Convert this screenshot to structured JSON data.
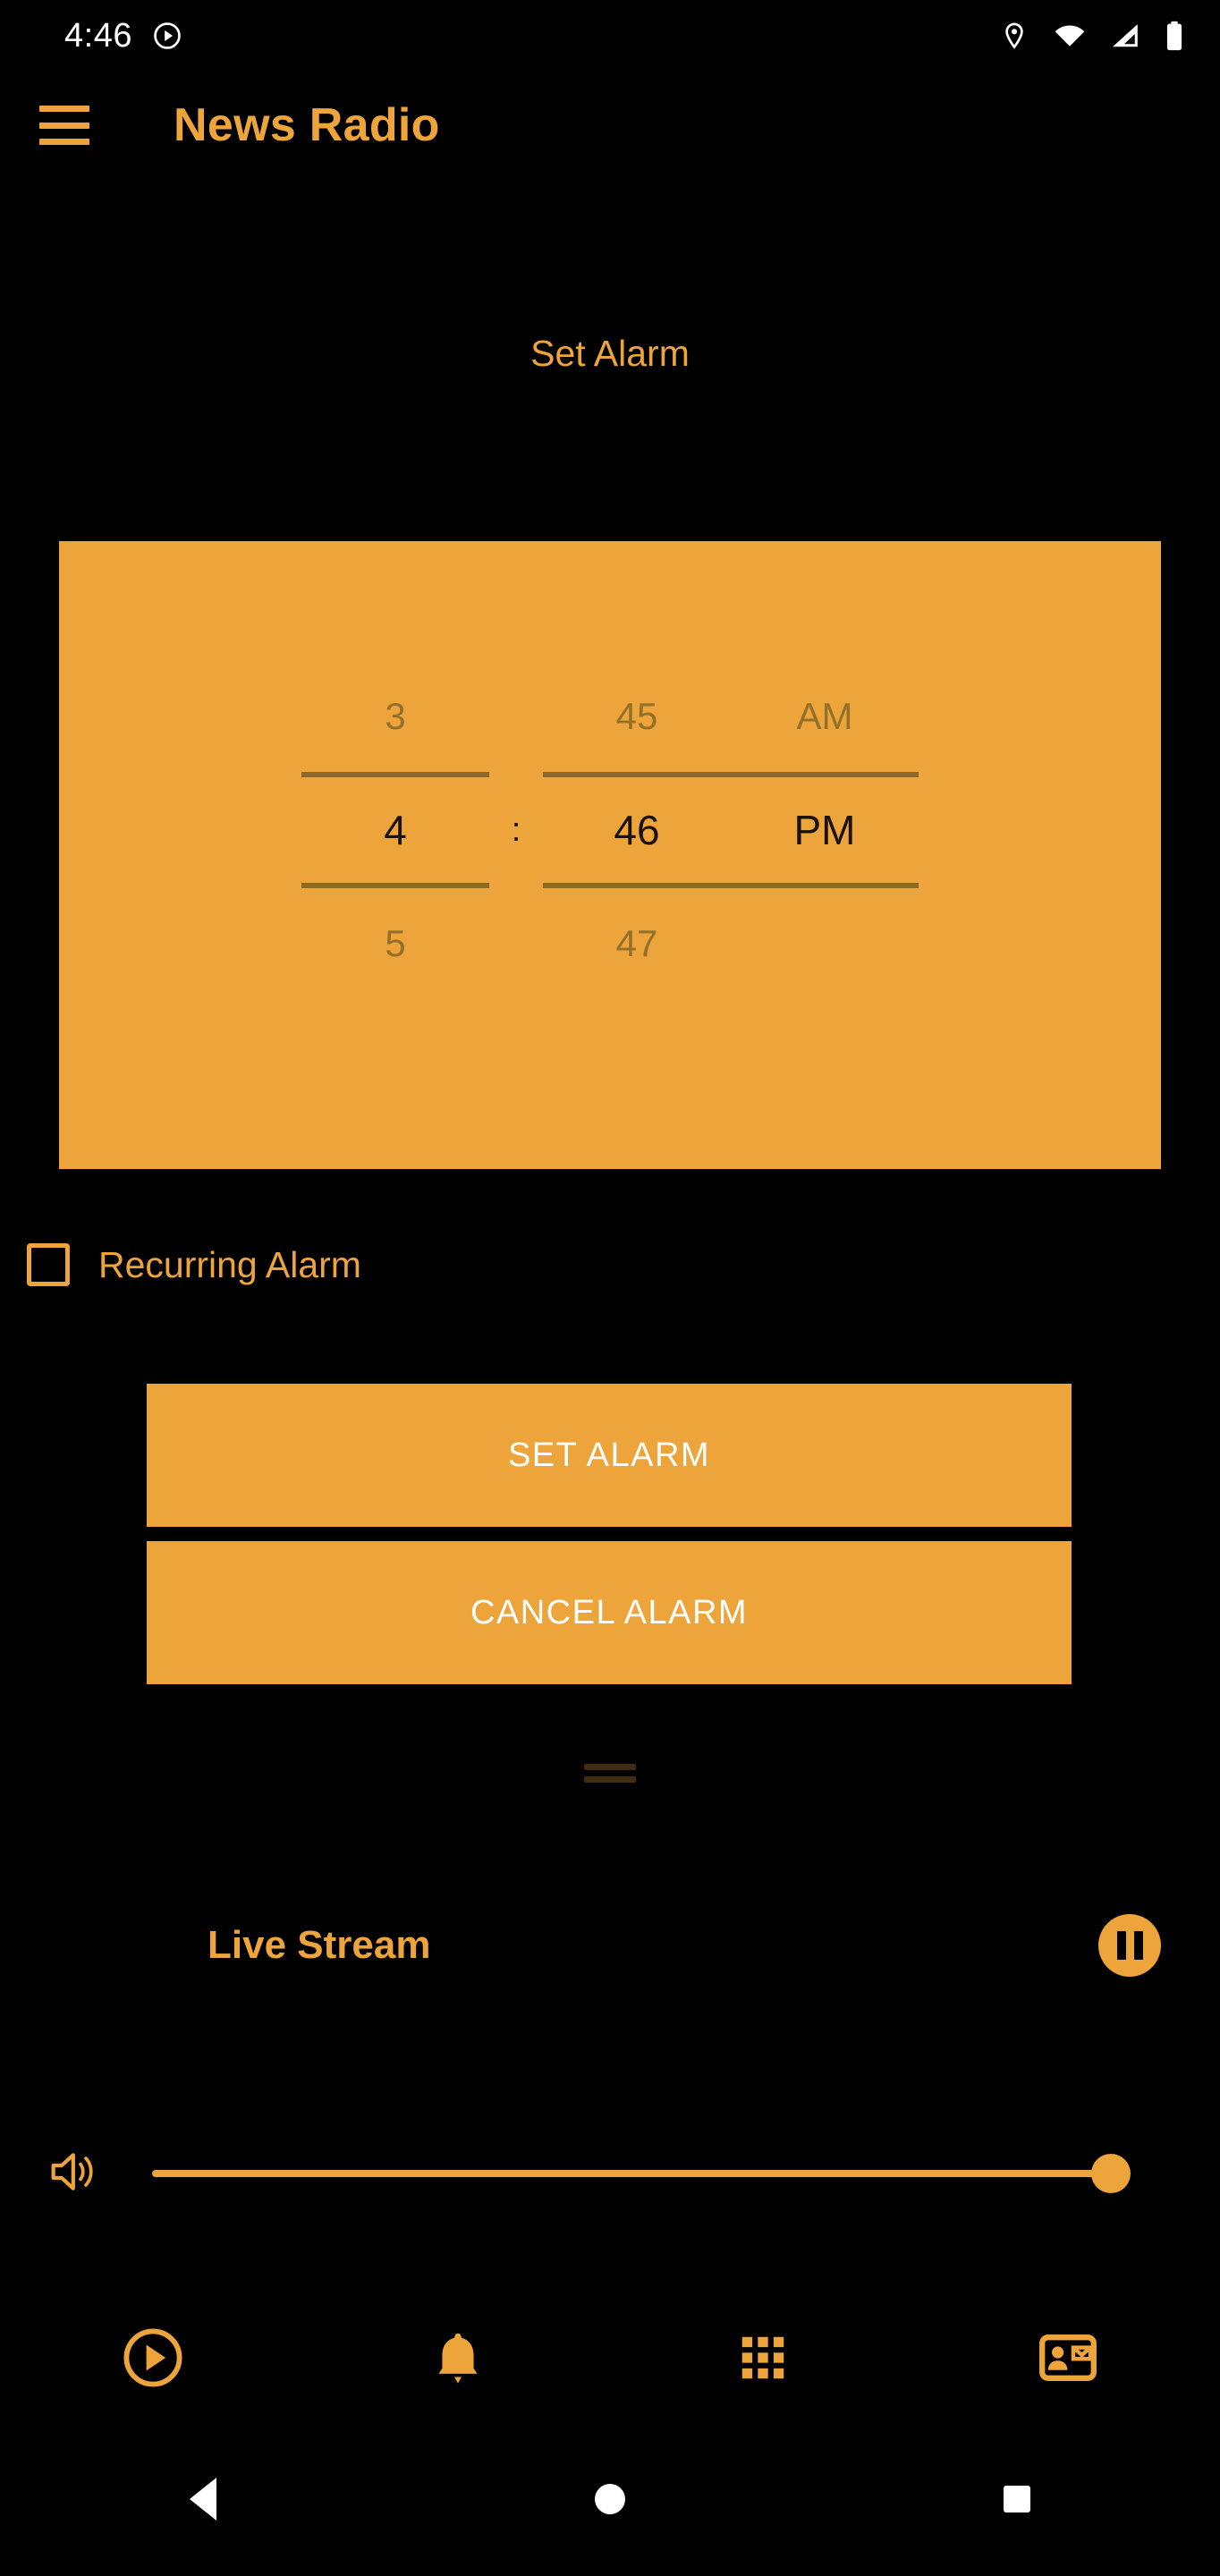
{
  "status_bar": {
    "clock": "4:46",
    "left_icons": [
      "play-circle-icon"
    ],
    "right_icons": [
      "location-pin-icon",
      "wifi-icon",
      "cellular-signal-icon",
      "battery-icon"
    ]
  },
  "app_bar": {
    "menu_icon": "hamburger-menu-icon",
    "title": "News Radio"
  },
  "alarm": {
    "heading": "Set Alarm",
    "picker": {
      "hour": {
        "previous": "3",
        "selected": "4",
        "next": "5"
      },
      "separator": ":",
      "minute": {
        "previous": "45",
        "selected": "46",
        "next": "47"
      },
      "meridiem": {
        "previous": "AM",
        "selected": "PM",
        "next": ""
      }
    },
    "recurring": {
      "label": "Recurring Alarm",
      "checked": false
    },
    "set_button": "SET ALARM",
    "cancel_button": "CANCEL ALARM"
  },
  "player": {
    "drag_handle": "drag-handle",
    "title": "Live Stream",
    "transport_icon": "pause-icon",
    "volume_icon": "volume-up-icon",
    "volume_level": 100
  },
  "bottom_nav": {
    "items": [
      {
        "icon": "play-circle-icon",
        "name": "nav-play"
      },
      {
        "icon": "bell-icon",
        "name": "nav-alarms"
      },
      {
        "icon": "grid-icon",
        "name": "nav-stations"
      },
      {
        "icon": "contact-card-icon",
        "name": "nav-contact"
      }
    ]
  },
  "system_nav": {
    "back": "back-triangle-icon",
    "home": "home-circle-icon",
    "recents": "recents-square-icon"
  },
  "colors": {
    "accent": "#eda43b",
    "background": "#000000",
    "panel": "#eda43b",
    "panel_text": "#1a1206",
    "panel_muted": "#94712a",
    "button_text": "#ffffff"
  }
}
